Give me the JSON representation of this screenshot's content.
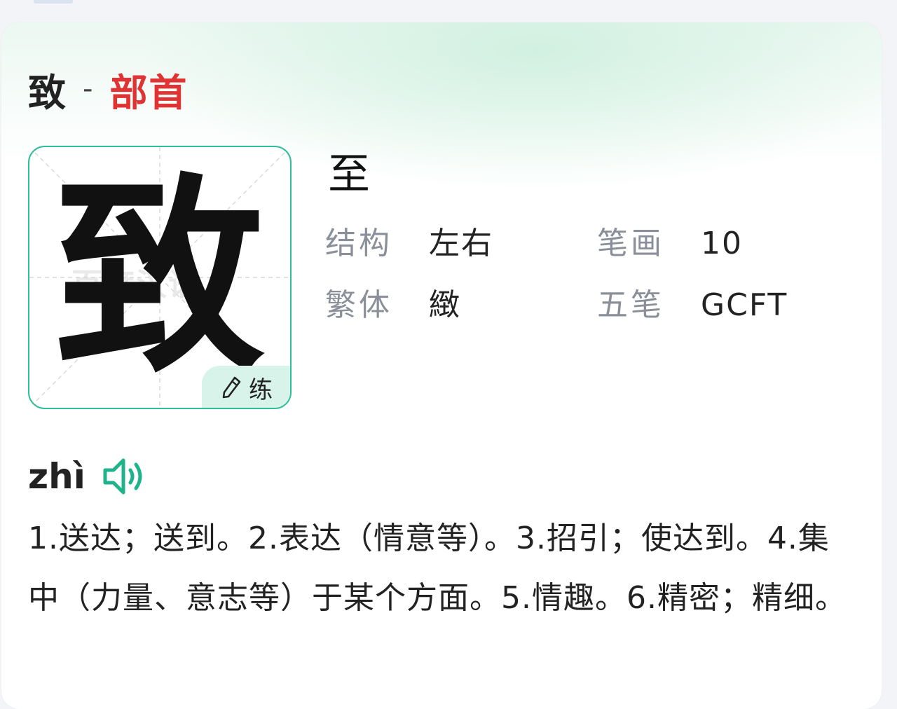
{
  "title": {
    "character": "致",
    "separator": "-",
    "radical_label": "部首"
  },
  "char_card": {
    "character": "致",
    "watermark": "百度汉语",
    "practice_label": "练"
  },
  "component": "至",
  "attributes": [
    {
      "label": "结构",
      "value": "左右"
    },
    {
      "label": "笔画",
      "value": "10"
    },
    {
      "label": "繁体",
      "value": "緻"
    },
    {
      "label": "五笔",
      "value": "GCFT"
    }
  ],
  "pronunciation": {
    "pinyin": "zhì"
  },
  "definition": "1.送达；送到。2.表达（情意等）。3.招引；使达到。4.集中（力量、意志等）于某个方面。5.情趣。6.精密；精细。",
  "colors": {
    "accent": "#2fbe9a",
    "radical": "#e03333",
    "practice_bg": "#d8f4ea"
  },
  "icons": [
    "pencil-icon",
    "speaker-icon"
  ]
}
